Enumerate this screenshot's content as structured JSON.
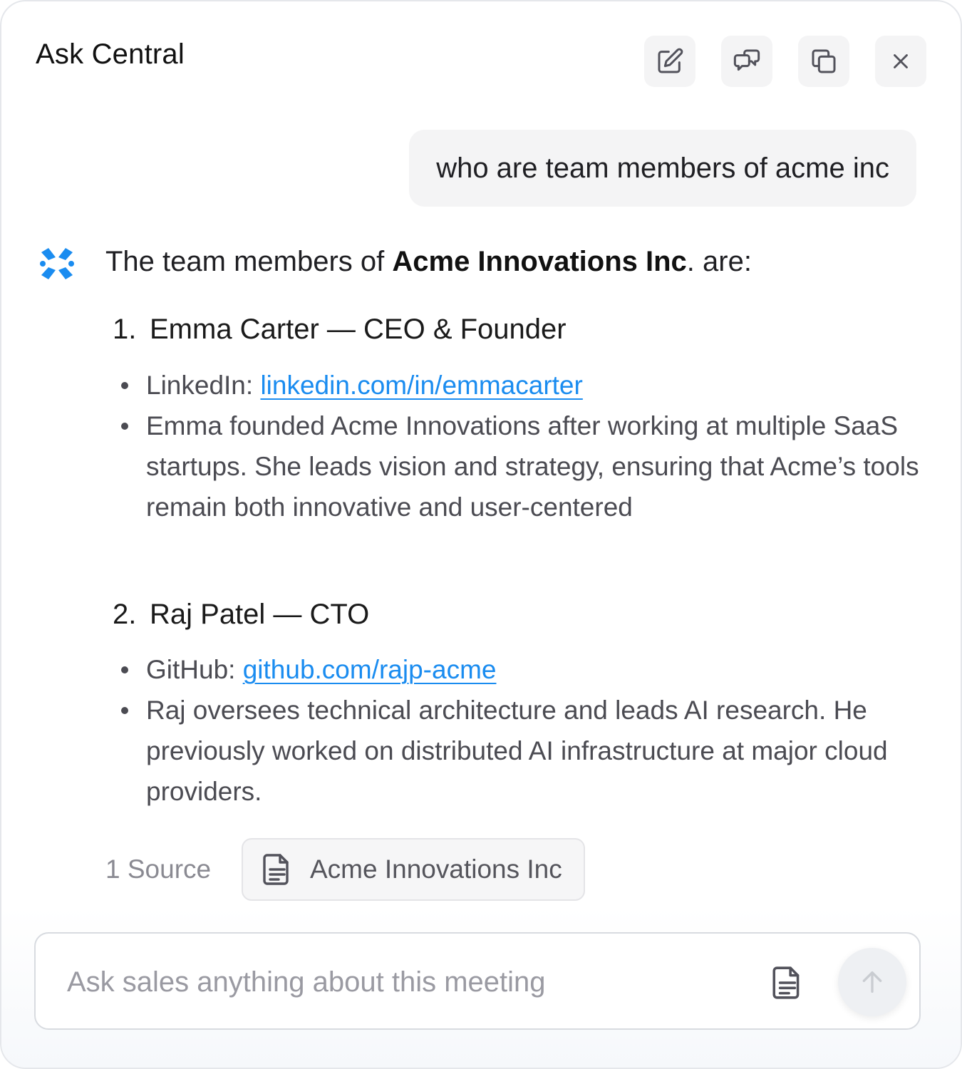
{
  "header": {
    "title": "Ask Central",
    "actions": [
      {
        "icon": "edit-icon",
        "label": "New chat"
      },
      {
        "icon": "chat-bubbles-icon",
        "label": "Conversations"
      },
      {
        "icon": "copy-icon",
        "label": "Copy"
      },
      {
        "icon": "close-icon",
        "label": "Close"
      }
    ]
  },
  "user_message": "who are team members of acme inc",
  "assistant": {
    "intro_prefix": "The team members of ",
    "intro_bold": "Acme Innovations Inc",
    "intro_suffix": ". are:",
    "members": [
      {
        "number": "1.",
        "heading": "Emma Carter — CEO & Founder",
        "link_label": "LinkedIn: ",
        "link_text": "linkedin.com/in/emmacarter",
        "bio": "Emma founded Acme Innovations after working at multiple SaaS startups.  She leads vision and strategy, ensuring that Acme’s tools remain both innovative and user-centered"
      },
      {
        "number": "2.",
        "heading": "Raj Patel — CTO",
        "link_label": "GitHub: ",
        "link_text": "github.com/rajp-acme",
        "bio": "Raj oversees technical architecture and leads AI research. He previously worked on distributed AI infrastructure at major cloud providers."
      }
    ]
  },
  "sources": {
    "label": "1 Source",
    "items": [
      {
        "icon": "document-icon",
        "title": "Acme Innovations Inc"
      }
    ]
  },
  "composer": {
    "placeholder": "Ask sales anything about this meeting",
    "value": ""
  },
  "colors": {
    "accent": "#1A8CF0",
    "bubble_bg": "#F4F4F5",
    "muted_text": "#8A8A92"
  }
}
